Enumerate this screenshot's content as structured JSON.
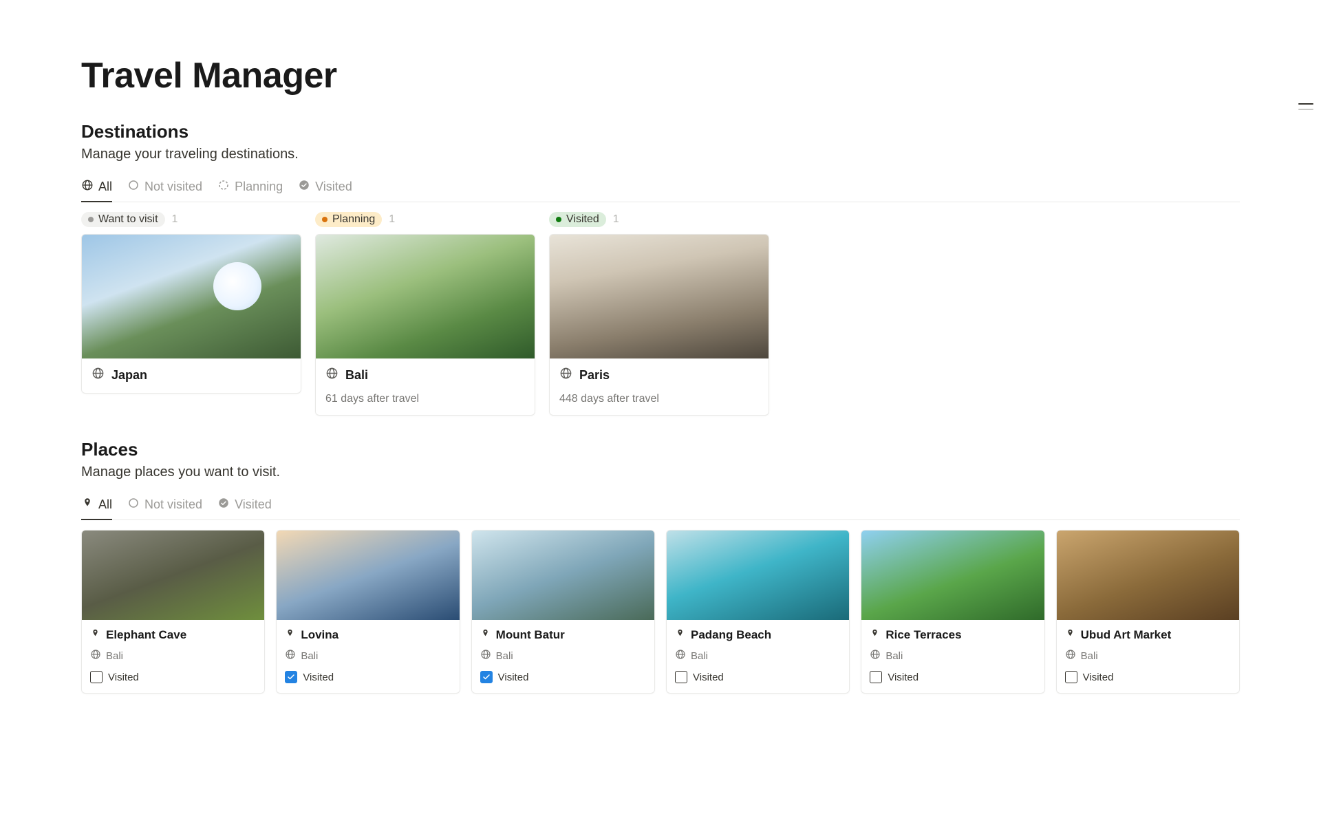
{
  "page": {
    "title": "Travel Manager"
  },
  "destinations_section": {
    "title": "Destinations",
    "description": "Manage your traveling destinations.",
    "tabs": [
      {
        "label": "All",
        "icon": "globe",
        "active": true
      },
      {
        "label": "Not visited",
        "icon": "circle",
        "active": false
      },
      {
        "label": "Planning",
        "icon": "dashed-circle",
        "active": false
      },
      {
        "label": "Visited",
        "icon": "check-circle",
        "active": false
      }
    ],
    "groups": [
      {
        "status_label": "Want to visit",
        "status_variant": "default",
        "count": 1,
        "cards": [
          {
            "title": "Japan",
            "icon": "globe",
            "subtext": "",
            "cover": "cov-japan"
          }
        ]
      },
      {
        "status_label": "Planning",
        "status_variant": "planning",
        "count": 1,
        "cards": [
          {
            "title": "Bali",
            "icon": "globe",
            "subtext": "61 days after travel",
            "cover": "cov-bali"
          }
        ]
      },
      {
        "status_label": "Visited",
        "status_variant": "visited",
        "count": 1,
        "cards": [
          {
            "title": "Paris",
            "icon": "globe",
            "subtext": "448 days after travel",
            "cover": "cov-paris"
          }
        ]
      }
    ]
  },
  "places_section": {
    "title": "Places",
    "description": "Manage places you want to visit.",
    "tabs": [
      {
        "label": "All",
        "icon": "pin",
        "active": true
      },
      {
        "label": "Not visited",
        "icon": "circle",
        "active": false
      },
      {
        "label": "Visited",
        "icon": "check-circle",
        "active": false
      }
    ],
    "visited_label": "Visited",
    "cards": [
      {
        "title": "Elephant Cave",
        "destination": "Bali",
        "visited": false,
        "cover": "cov-p0"
      },
      {
        "title": "Lovina",
        "destination": "Bali",
        "visited": true,
        "cover": "cov-p1"
      },
      {
        "title": "Mount Batur",
        "destination": "Bali",
        "visited": true,
        "cover": "cov-p2"
      },
      {
        "title": "Padang Beach",
        "destination": "Bali",
        "visited": false,
        "cover": "cov-p3"
      },
      {
        "title": "Rice Terraces",
        "destination": "Bali",
        "visited": false,
        "cover": "cov-p4"
      },
      {
        "title": "Ubud Art Market",
        "destination": "Bali",
        "visited": false,
        "cover": "cov-p5"
      }
    ]
  }
}
